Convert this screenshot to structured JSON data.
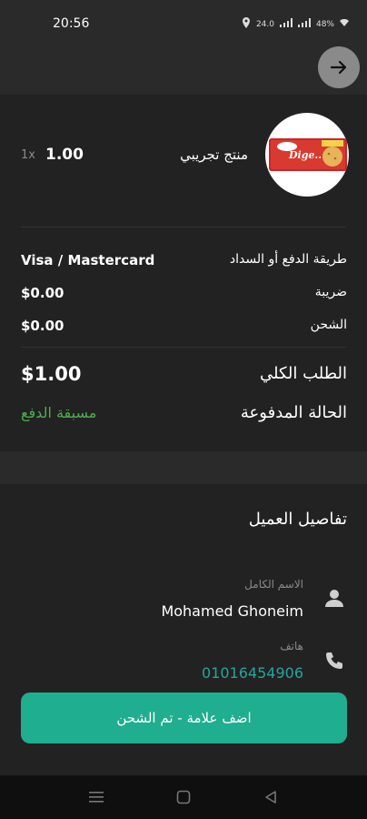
{
  "status_bar": {
    "time": "20:56",
    "network": "24.0",
    "battery": "48%"
  },
  "product": {
    "name": "منتج تجريبي",
    "quantity": "1x",
    "price": "1.00"
  },
  "summary": {
    "payment_method_label": "طريقة الدفع أو السداد",
    "payment_method_value": "Visa / Mastercard",
    "tax_label": "ضريبة",
    "tax_value": "$0.00",
    "shipping_label": "الشحن",
    "shipping_value": "$0.00",
    "total_label": "الطلب الكلي",
    "total_value": "$1.00",
    "payment_status_label": "الحالة المدفوعة",
    "payment_status_value": "مسبقة الدفع"
  },
  "customer": {
    "section_title": "تفاصيل العميل",
    "name_label": "الاسم الكامل",
    "name_value": "Mohamed Ghoneim",
    "phone_label": "هاتف",
    "phone_value": "01016454906"
  },
  "action_button": {
    "label": "اضف علامة - تم الشحن"
  },
  "colors": {
    "accent": "#1fae8f",
    "status_green": "#4caf50",
    "phone_link": "#26a69a"
  },
  "icons": [
    "arrow-right-icon",
    "person-icon",
    "phone-icon",
    "menu-icon",
    "home-icon",
    "back-icon"
  ]
}
